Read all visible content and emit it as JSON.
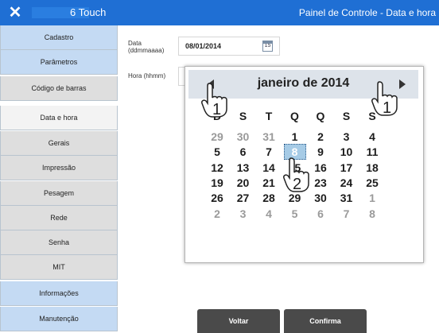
{
  "header": {
    "close_label": "✕",
    "model": "6 Touch",
    "title": "Painel de Controle - Data e hora"
  },
  "sidebar": {
    "items": [
      {
        "label": "Cadastro",
        "state": "blue"
      },
      {
        "label": "Parâmetros",
        "state": "blue"
      },
      {
        "label": "Código de barras",
        "state": "gray"
      },
      {
        "label": "Data e hora",
        "state": "active"
      },
      {
        "label": "Gerais",
        "state": "gray"
      },
      {
        "label": "Impressão",
        "state": "gray"
      },
      {
        "label": "Pesagem",
        "state": "gray"
      },
      {
        "label": "Rede",
        "state": "gray"
      },
      {
        "label": "Senha",
        "state": "gray"
      },
      {
        "label": "MIT",
        "state": "gray"
      },
      {
        "label": "Informações",
        "state": "blue"
      },
      {
        "label": "Manutenção",
        "state": "blue"
      }
    ]
  },
  "form": {
    "date_label_1": "Data",
    "date_label_2": "(ddmmaaaa)",
    "date_value": "08/01/2014",
    "calendar_icon_text": "15",
    "hour_label": "Hora (hhmm)"
  },
  "calendar": {
    "title": "janeiro de 2014",
    "weekdays": [
      "D",
      "S",
      "T",
      "Q",
      "Q",
      "S",
      "S"
    ],
    "weeks": [
      [
        "29",
        "30",
        "31",
        "1",
        "2",
        "3",
        "4"
      ],
      [
        "5",
        "6",
        "7",
        "8",
        "9",
        "10",
        "11"
      ],
      [
        "12",
        "13",
        "14",
        "15",
        "16",
        "17",
        "18"
      ],
      [
        "19",
        "20",
        "21",
        "22",
        "23",
        "24",
        "25"
      ],
      [
        "26",
        "27",
        "28",
        "29",
        "30",
        "31",
        "1"
      ],
      [
        "2",
        "3",
        "4",
        "5",
        "6",
        "7",
        "8"
      ]
    ],
    "other_month": [
      [
        true,
        true,
        true,
        false,
        false,
        false,
        false
      ],
      [
        false,
        false,
        false,
        false,
        false,
        false,
        false
      ],
      [
        false,
        false,
        false,
        false,
        false,
        false,
        false
      ],
      [
        false,
        false,
        false,
        false,
        false,
        false,
        false
      ],
      [
        false,
        false,
        false,
        false,
        false,
        false,
        true
      ],
      [
        true,
        true,
        true,
        true,
        true,
        true,
        true
      ]
    ],
    "selected": "8"
  },
  "hints": {
    "prev_step": "1",
    "day_step": "2",
    "next_step": "1"
  },
  "buttons": {
    "back": "Voltar",
    "confirm": "Confirma"
  },
  "colors": {
    "header": "#1f6fd4",
    "sidebar_blue": "#c4daf3",
    "sidebar_gray": "#dedede",
    "selected_day": "#a6cbe6",
    "button": "#4a4a4a"
  }
}
